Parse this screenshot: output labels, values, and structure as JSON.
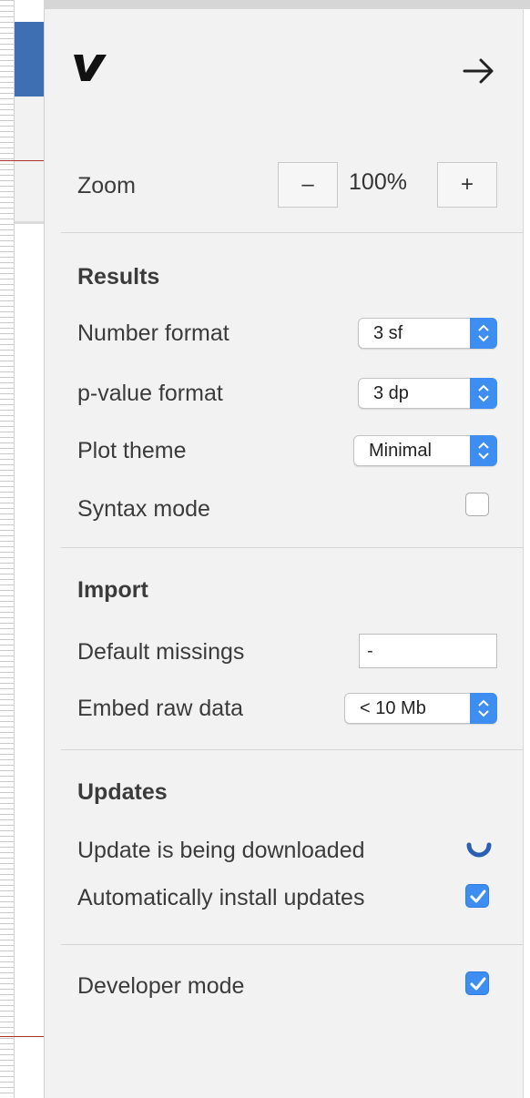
{
  "panel": {
    "logo_icon": "jamovi-logo-icon",
    "collapse_icon": "arrow-right-icon"
  },
  "zoom": {
    "label": "Zoom",
    "decrease_label": "–",
    "level": "100%",
    "increase_label": "+"
  },
  "results": {
    "heading": "Results",
    "number_format": {
      "label": "Number format",
      "value": "3 sf"
    },
    "pvalue_format": {
      "label": "p-value format",
      "value": "3 dp"
    },
    "plot_theme": {
      "label": "Plot theme",
      "value": "Minimal"
    },
    "syntax_mode": {
      "label": "Syntax mode",
      "checked": false
    }
  },
  "import": {
    "heading": "Import",
    "default_missings": {
      "label": "Default missings",
      "value": "-"
    },
    "embed_raw_data": {
      "label": "Embed raw data",
      "value": "< 10 Mb"
    }
  },
  "updates": {
    "heading": "Updates",
    "status_label": "Update is being downloaded",
    "status_icon": "loading-spinner-icon",
    "auto_install": {
      "label": "Automatically install updates",
      "checked": true
    }
  },
  "developer_mode": {
    "label": "Developer mode",
    "checked": true
  },
  "colors": {
    "accent": "#3d8ef0",
    "panel_bg": "#f2f2f2",
    "spinner": "#2a5fb4"
  }
}
